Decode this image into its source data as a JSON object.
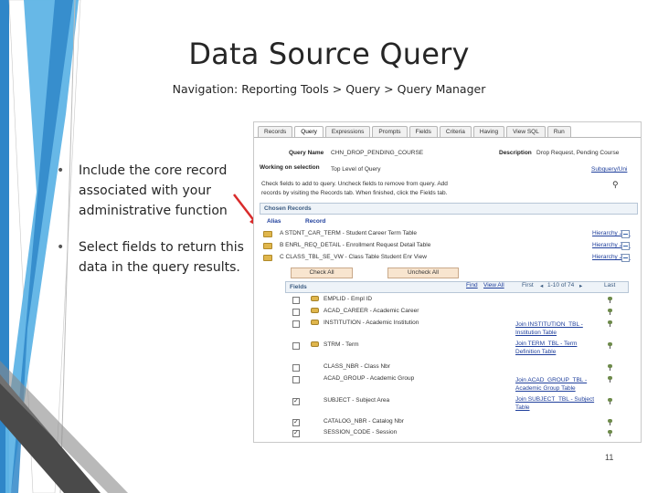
{
  "slide": {
    "title": "Data Source Query",
    "subtitle": "Navigation: Reporting Tools > Query > Query Manager",
    "bullets": [
      {
        "text": "Include the core record associated with your administrative function"
      },
      {
        "text": "Select fields to return this data in the query results."
      }
    ],
    "page_number": "11"
  },
  "screenshot": {
    "tabs": [
      "Records",
      "Query",
      "Expressions",
      "Prompts",
      "Fields",
      "Criteria",
      "Having",
      "View SQL",
      "Run"
    ],
    "active_tab": "Query",
    "query_name_label": "Query Name",
    "query_name_value": "CHN_DROP_PENDING_COURSE",
    "description_label": "Description",
    "description_value": "Drop Request, Pending Course",
    "working_label": "Working on selection",
    "working_value": "Top Level of Query",
    "subquery_link": "Subquery/Uni",
    "hint_line1": "Check fields to add to query. Uncheck fields to remove from query. Add",
    "hint_line2": "records by visiting the Records tab. When finished, click the Fields tab.",
    "chosen_records_title": "Chosen Records",
    "alias_header": "Alias",
    "record_header": "Record",
    "records": [
      {
        "text": "A  STDNT_CAR_TERM - Student Career Term Table",
        "join": "Hierarchy Join"
      },
      {
        "text": "B  ENRL_REQ_DETAIL - Enrollment Request Detail Table",
        "join": "Hierarchy Join"
      },
      {
        "text": "C  CLASS_TBL_SE_VW - Class Table Student Enr View",
        "join": "Hierarchy Join"
      }
    ],
    "check_all_label": "Check All",
    "uncheck_all_label": "Uncheck All",
    "fields_title": "Fields",
    "find_label": "Find",
    "view_all_label": "View All",
    "first_label": "First",
    "page_label": "1-10 of 74",
    "last_label": "Last",
    "fields": [
      {
        "name": "EMPLID - Empl ID",
        "checked": false,
        "key": true,
        "join": ""
      },
      {
        "name": "ACAD_CAREER - Academic Career",
        "checked": false,
        "key": true,
        "join": ""
      },
      {
        "name": "INSTITUTION - Academic Institution",
        "checked": false,
        "key": true,
        "join": "Join INSTITUTION_TBL - Institution Table"
      },
      {
        "name": "STRM - Term",
        "checked": false,
        "key": true,
        "join": "Join TERM_TBL - Term Definition Table"
      },
      {
        "name": "CLASS_NBR - Class Nbr",
        "checked": false,
        "key": false,
        "join": ""
      },
      {
        "name": "ACAD_GROUP - Academic Group",
        "checked": false,
        "key": false,
        "join": "Join ACAD_GROUP_TBL - Academic Group Table"
      },
      {
        "name": "SUBJECT - Subject Area",
        "checked": true,
        "key": false,
        "join": "Join SUBJECT_TBL - Subject Table"
      },
      {
        "name": "CATALOG_NBR - Catalog Nbr",
        "checked": true,
        "key": false,
        "join": ""
      },
      {
        "name": "SESSION_CODE - Session",
        "checked": true,
        "key": false,
        "join": ""
      }
    ]
  },
  "colors": {
    "accent_blue": "#2f86c8",
    "light_blue": "#5fb4e6",
    "deco_gray": "#4a4a4a",
    "arrow_red": "#d92b2b"
  }
}
